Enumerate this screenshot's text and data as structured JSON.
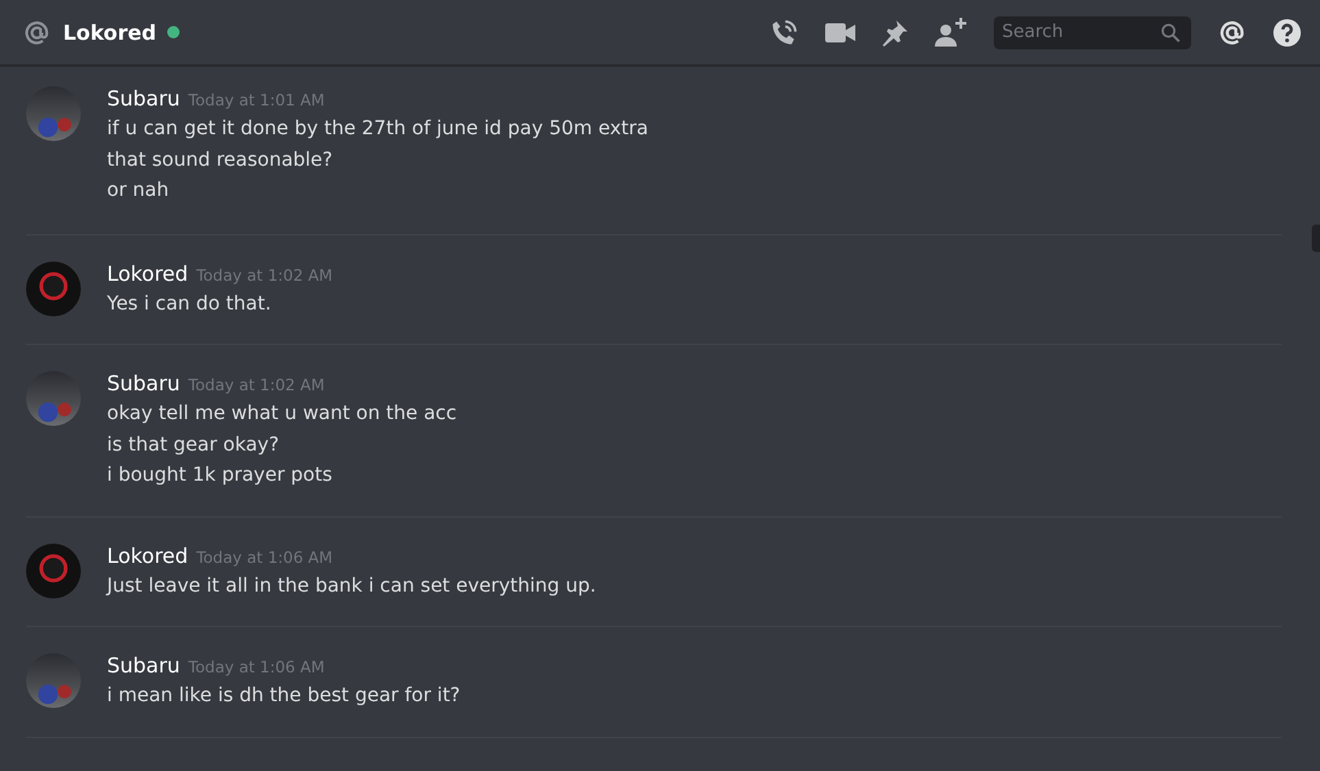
{
  "header": {
    "title": "Lokored",
    "online": true,
    "search": {
      "placeholder": "Search"
    }
  },
  "messages": [
    {
      "author": "Subaru",
      "kind": "car",
      "timestamp": "Today at 1:01 AM",
      "lines": [
        "if u can get it done by the 27th of june id pay 50m extra",
        "that sound reasonable?",
        "or nah"
      ]
    },
    {
      "author": "Lokored",
      "kind": "logo",
      "timestamp": "Today at 1:02 AM",
      "lines": [
        "Yes i can do that."
      ]
    },
    {
      "author": "Subaru",
      "kind": "car",
      "timestamp": "Today at 1:02 AM",
      "lines": [
        "okay tell me what u want on the acc",
        "is that gear okay?",
        "i bought 1k prayer pots"
      ]
    },
    {
      "author": "Lokored",
      "kind": "logo",
      "timestamp": "Today at 1:06 AM",
      "lines": [
        "Just leave it all in the bank i can set everything up."
      ]
    },
    {
      "author": "Subaru",
      "kind": "car",
      "timestamp": "Today at 1:06 AM",
      "lines": [
        "i mean like is dh the best gear for it?"
      ]
    }
  ]
}
